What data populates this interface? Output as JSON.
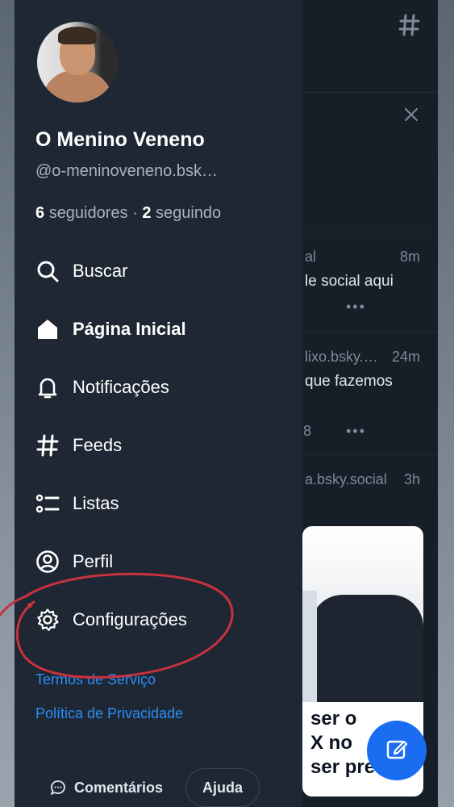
{
  "profile": {
    "name": "O Menino Veneno",
    "handle": "@o-meninoveneno.bsk…",
    "followers_count": "6",
    "followers_label": "seguidores ·",
    "following_count": "2",
    "following_label": "seguindo"
  },
  "nav": {
    "items": [
      {
        "label": "Buscar",
        "icon": "search-icon"
      },
      {
        "label": "Página Inicial",
        "icon": "home-icon",
        "active": true
      },
      {
        "label": "Notificações",
        "icon": "bell-icon"
      },
      {
        "label": "Feeds",
        "icon": "hash-icon"
      },
      {
        "label": "Listas",
        "icon": "list-icon"
      },
      {
        "label": "Perfil",
        "icon": "user-circle-icon"
      },
      {
        "label": "Configurações",
        "icon": "gear-icon"
      }
    ]
  },
  "links": {
    "terms": "Termos de Serviço",
    "privacy": "Política de Privacidade"
  },
  "footer": {
    "feedback": "Comentários",
    "help": "Ajuda"
  },
  "background_feed": {
    "posts": [
      {
        "handle": "al",
        "time": "8m",
        "text": "le social aqui"
      },
      {
        "handle": "lixo.bsky.…",
        "time": "24m",
        "text": "que fazemos",
        "count": "8"
      },
      {
        "handle": "a.bsky.social",
        "time": "3h"
      }
    ],
    "embed_caption": [
      "ser o",
      "X no",
      "ser preso"
    ]
  },
  "colors": {
    "drawer_bg": "#1e2733",
    "link": "#2b8df7",
    "fab": "#1a6cf0",
    "annotation": "#c8323e"
  }
}
